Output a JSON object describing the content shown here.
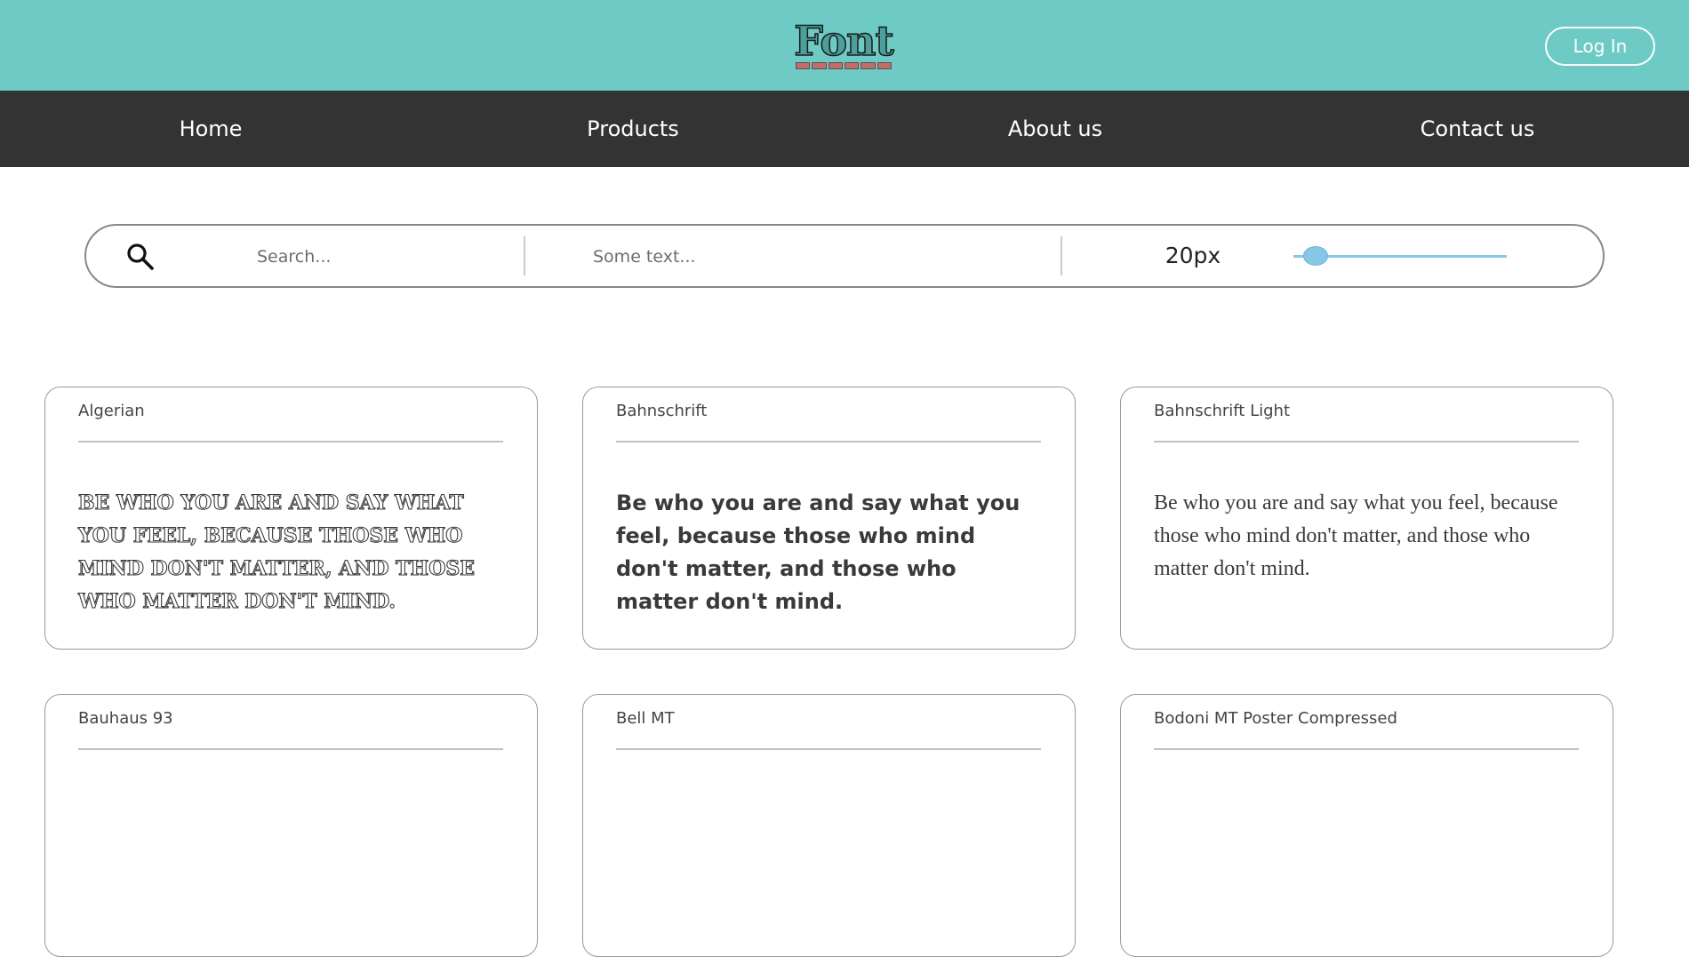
{
  "header": {
    "logo_text": "Font",
    "login_label": "Log In",
    "brand_color": "#6ecac5"
  },
  "nav": {
    "items": [
      {
        "label": "Home"
      },
      {
        "label": "Products"
      },
      {
        "label": "About us"
      },
      {
        "label": "Contact us"
      }
    ]
  },
  "controls": {
    "search_placeholder": "Search...",
    "sample_placeholder": "Some text...",
    "size_value": "20px",
    "slider_value_fraction": 0.05
  },
  "fonts": [
    {
      "name": "Algerian",
      "sample": "Be who you are and say what you feel, because those who mind don't matter, and those who matter don't mind."
    },
    {
      "name": "Bahnschrift",
      "sample": "Be who you are and say what you feel, because those who mind don't matter, and those who matter don't mind."
    },
    {
      "name": "Bahnschrift Light",
      "sample": "Be who you are and say what you feel, because those who mind don't matter, and those who matter don't mind."
    },
    {
      "name": "Bauhaus 93",
      "sample": ""
    },
    {
      "name": "Bell MT",
      "sample": ""
    },
    {
      "name": "Bodoni MT Poster Compressed",
      "sample": ""
    }
  ]
}
